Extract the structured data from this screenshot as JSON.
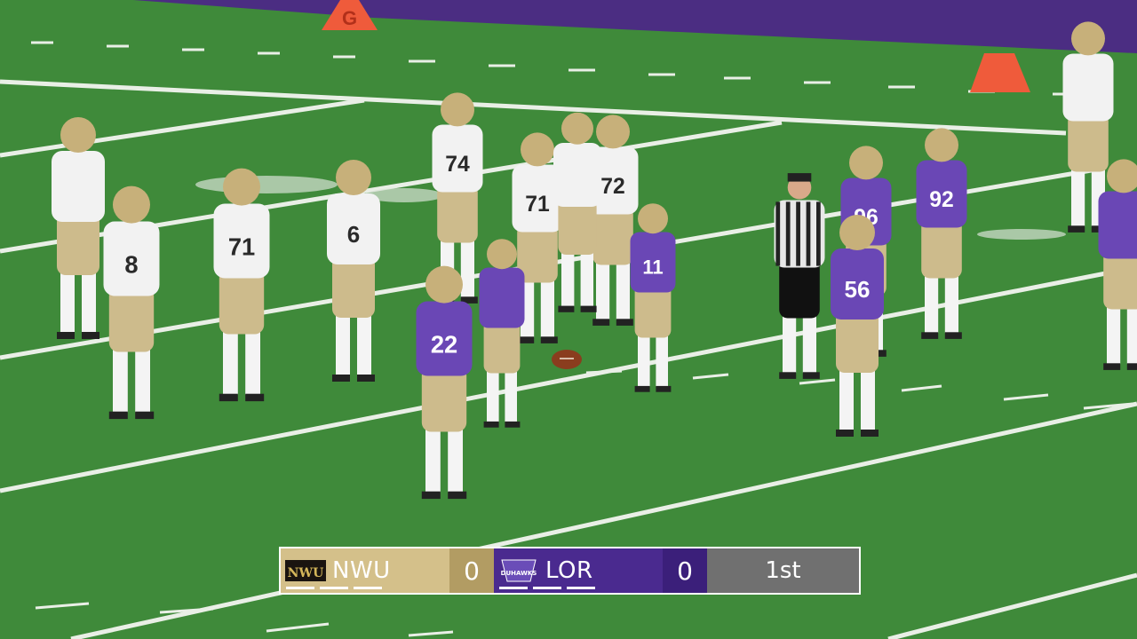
{
  "scene": {
    "description_colors": {
      "turf": "#3f8a3a",
      "sideline_purple": "#4b2d82",
      "home_jersey": "#f2f2f2",
      "away_jersey": "#6a47b5",
      "pants": "#cdbb8c",
      "pylon": "#ef5b3b"
    },
    "jersey_numbers": [
      "8",
      "71",
      "6",
      "74",
      "71",
      "72",
      "22",
      "11",
      "96",
      "92",
      "56"
    ],
    "pylon_letter": "G"
  },
  "scoreboard": {
    "home": {
      "abbr": "NWU",
      "score": "0",
      "logo_text": "NWU",
      "color": "#d4c08a",
      "timeouts": 3
    },
    "away": {
      "abbr": "LOR",
      "score": "0",
      "logo_text": "DUHAWKS",
      "color": "#4a2a8f",
      "timeouts": 3
    },
    "period": "1st"
  }
}
